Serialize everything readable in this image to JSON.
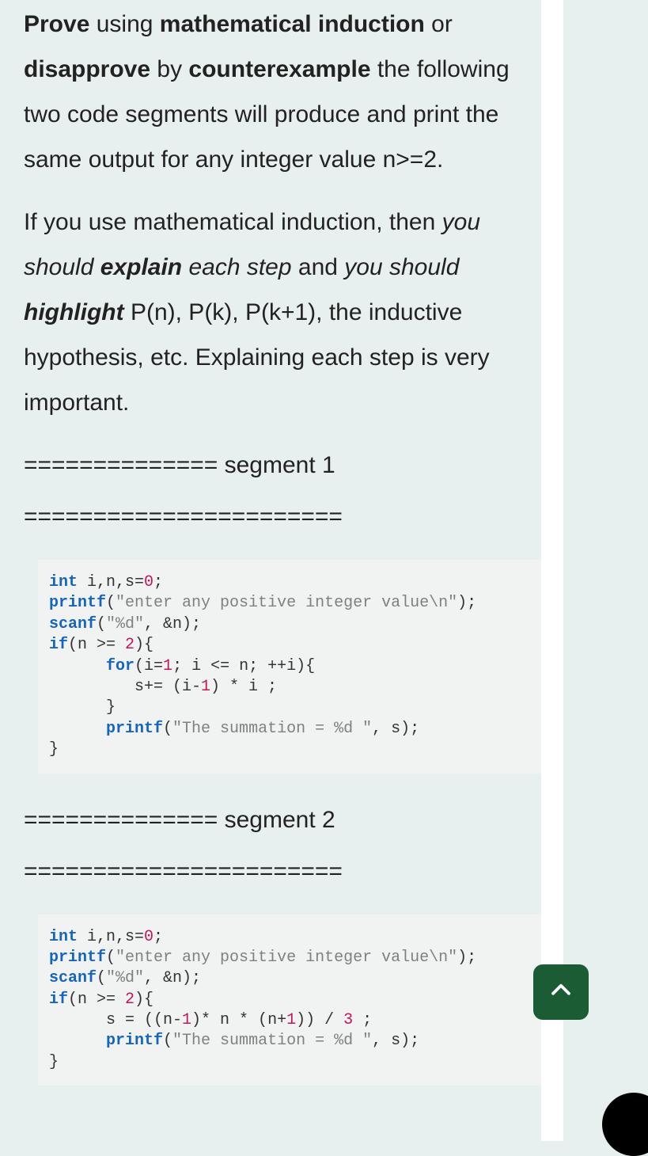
{
  "paragraphs": {
    "p1": {
      "prove": "Prove",
      "using": " using ",
      "mi": "mathematical induction",
      "or": " or ",
      "disapprove": "disapprove",
      "by": " by ",
      "ce": "counterexample",
      "rest": " the following two code segments will produce and print the same output for any integer value n>=2."
    },
    "p2": {
      "a": "If you use mathematical induction, then ",
      "ys1": "you should ",
      "explain": "explain",
      "es": " each step",
      "and": " and ",
      "ys2": "you should ",
      "highlight": "highlight",
      "rest": " P(n), P(k), P(k+1), the inductive hypothesis, etc. Explaining each step is very important."
    }
  },
  "segments": {
    "s1": {
      "header_eq": "============== ",
      "label": "segment 1",
      "divider": "======================="
    },
    "s2": {
      "header_eq": "============== ",
      "label": "segment 2",
      "divider": "======================="
    }
  },
  "code1": {
    "l0a": "int",
    "l0b": " i,n,s=",
    "l0n": "0",
    "l0c": ";",
    "l1a": "printf",
    "l1b": "(",
    "l1s": "\"enter any positive integer value\\n\"",
    "l1c": ");",
    "l2a": "scanf",
    "l2b": "(",
    "l2s": "\"%d\"",
    "l2c": ", &n);",
    "l3a": "if",
    "l3b": "(n >= ",
    "l3n": "2",
    "l3c": "){",
    "l4a": "      for",
    "l4b": "(i=",
    "l4n1": "1",
    "l4c": "; i <= n; ++i){",
    "l5a": "         s+= (i-",
    "l5n": "1",
    "l5b": ") * i ;",
    "l6": "      }",
    "l7a": "      printf",
    "l7b": "(",
    "l7s": "\"The summation = %d \"",
    "l7c": ", s);",
    "l8": "}"
  },
  "code2": {
    "l0a": "int",
    "l0b": " i,n,s=",
    "l0n": "0",
    "l0c": ";",
    "l1a": "printf",
    "l1b": "(",
    "l1s": "\"enter any positive integer value\\n\"",
    "l1c": ");",
    "l2a": "scanf",
    "l2b": "(",
    "l2s": "\"%d\"",
    "l2c": ", &n);",
    "l3a": "if",
    "l3b": "(n >= ",
    "l3n": "2",
    "l3c": "){",
    "l4a": "      s = ((n-",
    "l4n1": "1",
    "l4b": ")* n * (n+",
    "l4n2": "1",
    "l4c": ")) / ",
    "l4n3": "3",
    "l4d": " ;",
    "l5a": "      printf",
    "l5b": "(",
    "l5s": "\"The summation = %d \"",
    "l5c": ", s);",
    "l6": "}"
  },
  "icons": {
    "scroll_top": "chevron-up-icon",
    "chat": "chat-bubble-icon"
  }
}
